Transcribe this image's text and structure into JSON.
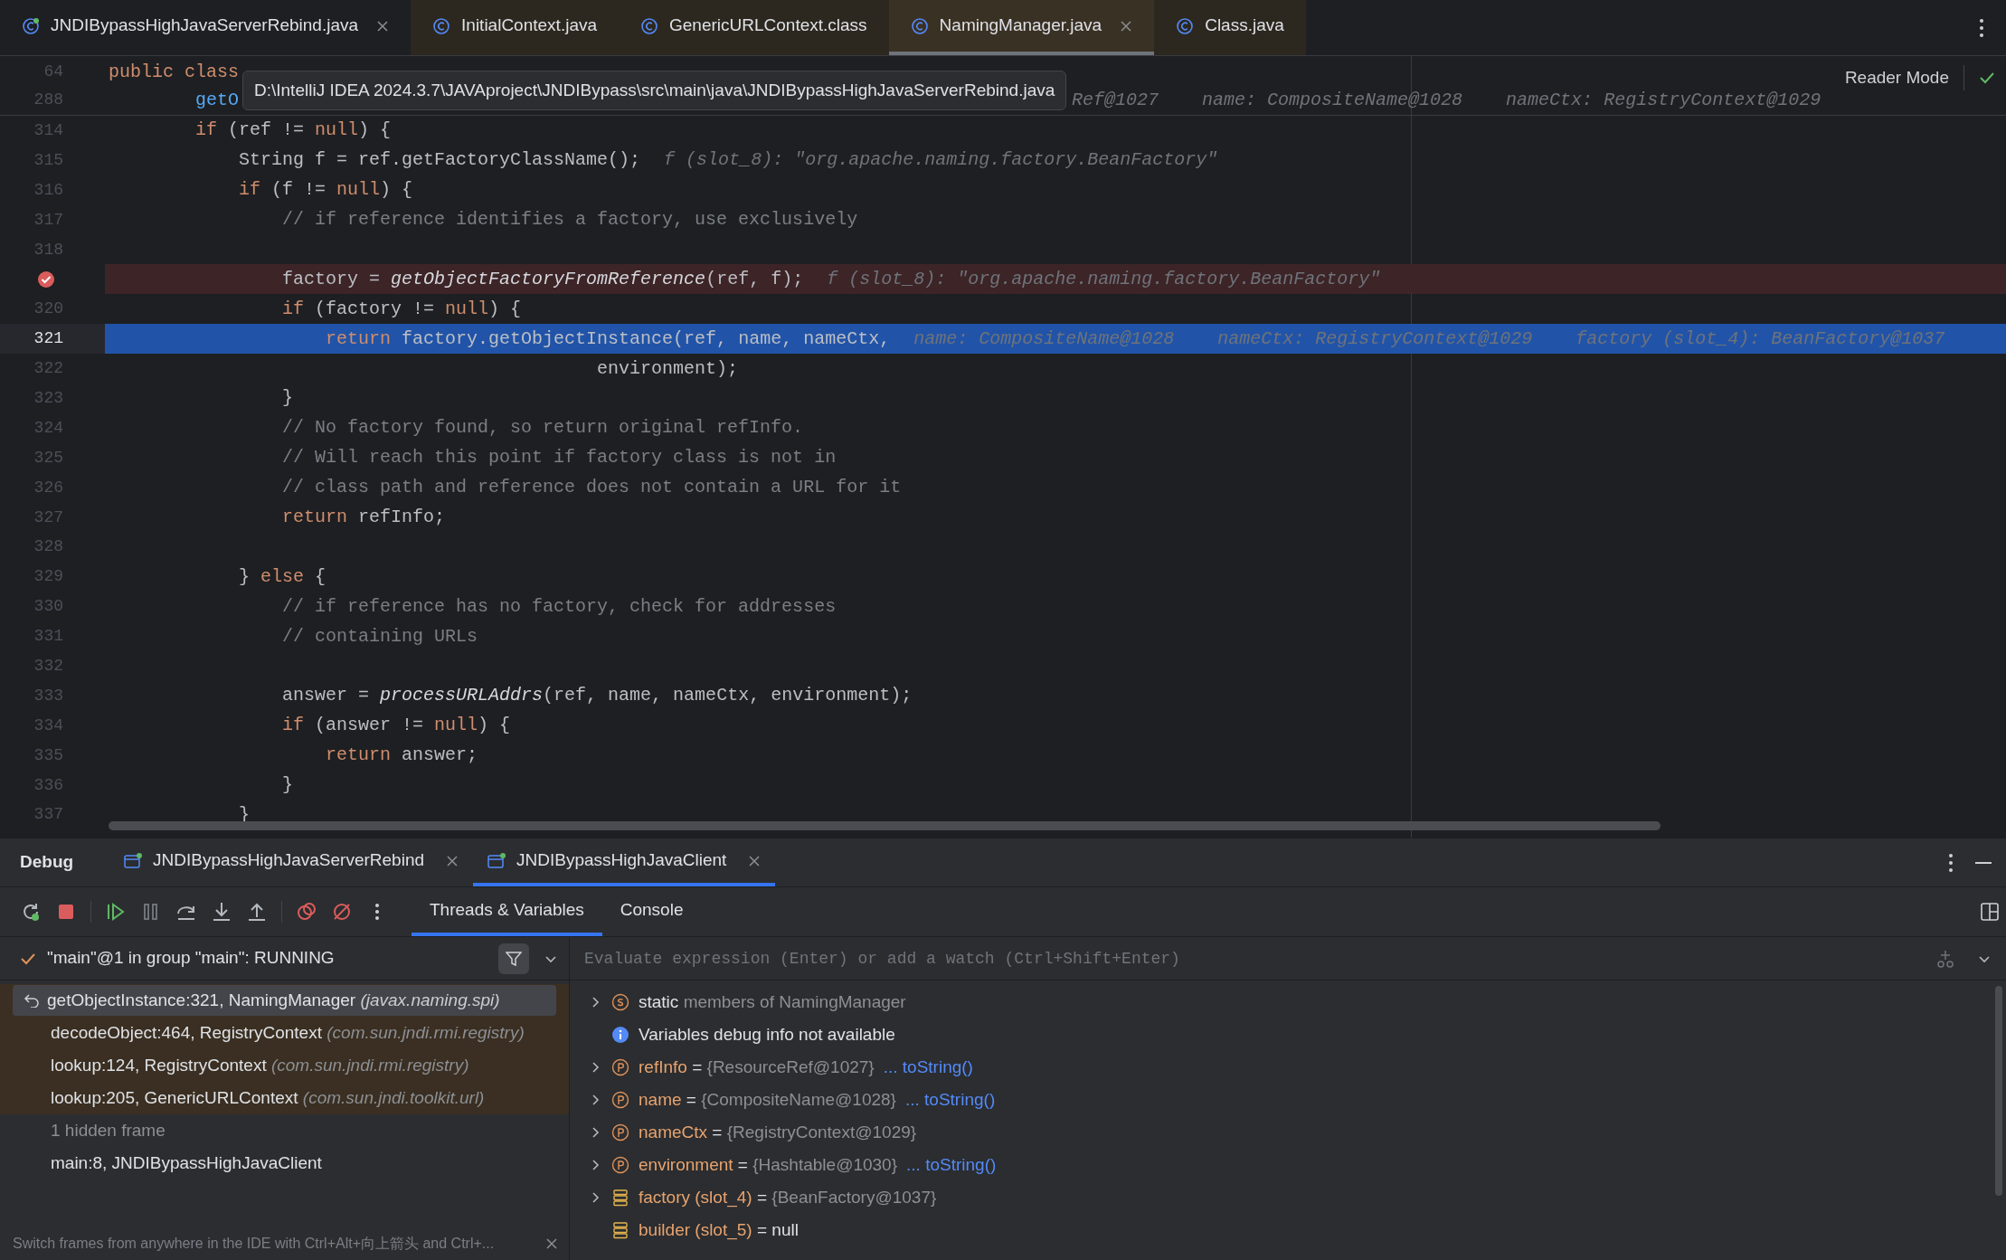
{
  "editor_tabs": [
    {
      "label": "JNDIBypassHighJavaServerRebind.java",
      "selected": false,
      "library": false,
      "closable": true,
      "runnable": true
    },
    {
      "label": "InitialContext.java",
      "selected": false,
      "library": true,
      "closable": false,
      "runnable": false
    },
    {
      "label": "GenericURLContext.class",
      "selected": false,
      "library": true,
      "closable": false,
      "runnable": false
    },
    {
      "label": "NamingManager.java",
      "selected": true,
      "library": true,
      "closable": true,
      "runnable": false
    },
    {
      "label": "Class.java",
      "selected": false,
      "library": true,
      "closable": false,
      "runnable": false
    }
  ],
  "reader_mode": "Reader Mode",
  "tooltip": "D:\\IntelliJ IDEA 2024.3.7\\JAVAproject\\JNDIBypass\\src\\main\\java\\JNDIBypassHighJavaServerRebind.java",
  "sticky_lines": [
    {
      "number": "64",
      "segments": [
        {
          "kind": "keyword",
          "text": "public class"
        }
      ]
    },
    {
      "number": "288",
      "segments": [
        {
          "kind": "method",
          "text": "        getO"
        },
        {
          "kind": "hint",
          "text": "Ref@1027    name: CompositeName@1028    nameCtx: RegistryContext@1029"
        }
      ]
    }
  ],
  "code_lines": [
    {
      "number": "314",
      "breakpoint": false,
      "current": false,
      "segments": [
        {
          "kind": "keyword",
          "text": "        if"
        },
        {
          "kind": "plain",
          "text": " (ref != "
        },
        {
          "kind": "keyword",
          "text": "null"
        },
        {
          "kind": "plain",
          "text": ") {"
        }
      ]
    },
    {
      "number": "315",
      "breakpoint": false,
      "current": false,
      "segments": [
        {
          "kind": "plain",
          "text": "            String f = ref.getFactoryClassName();"
        },
        {
          "kind": "hint",
          "text": "f (slot_8): \"org.apache.naming.factory.BeanFactory\""
        }
      ]
    },
    {
      "number": "316",
      "breakpoint": false,
      "current": false,
      "segments": [
        {
          "kind": "keyword",
          "text": "            if"
        },
        {
          "kind": "plain",
          "text": " (f != "
        },
        {
          "kind": "keyword",
          "text": "null"
        },
        {
          "kind": "plain",
          "text": ") {"
        }
      ]
    },
    {
      "number": "317",
      "breakpoint": false,
      "current": false,
      "segments": [
        {
          "kind": "comment",
          "text": "                // if reference identifies a factory, use exclusively"
        }
      ]
    },
    {
      "number": "318",
      "breakpoint": false,
      "current": false
    },
    {
      "breakpoint": true,
      "current": false,
      "segments": [
        {
          "kind": "plain",
          "text": "                factory = "
        },
        {
          "kind": "static",
          "text": "getObjectFactoryFromReference"
        },
        {
          "kind": "plain",
          "text": "(ref, f);"
        },
        {
          "kind": "hint",
          "text": "f (slot_8): \"org.apache.naming.factory.BeanFactory\""
        }
      ]
    },
    {
      "number": "320",
      "breakpoint": false,
      "current": false,
      "segments": [
        {
          "kind": "keyword",
          "text": "                if"
        },
        {
          "kind": "plain",
          "text": " (factory != "
        },
        {
          "kind": "keyword",
          "text": "null"
        },
        {
          "kind": "plain",
          "text": ") {"
        }
      ]
    },
    {
      "number": "321",
      "breakpoint": false,
      "current": true,
      "segments": [
        {
          "kind": "keyword",
          "text": "                    return"
        },
        {
          "kind": "plain",
          "text": " factory.getObjectInstance(ref, name, nameCtx,"
        },
        {
          "kind": "hint",
          "text": "name: CompositeName@1028    nameCtx: RegistryContext@1029    factory (slot_4): BeanFactory@1037"
        }
      ]
    },
    {
      "number": "322",
      "breakpoint": false,
      "current": false,
      "segments": [
        {
          "kind": "plain",
          "text": "                                             environment);"
        }
      ]
    },
    {
      "number": "323",
      "breakpoint": false,
      "current": false,
      "segments": [
        {
          "kind": "plain",
          "text": "                }"
        }
      ]
    },
    {
      "number": "324",
      "breakpoint": false,
      "current": false,
      "segments": [
        {
          "kind": "comment",
          "text": "                // No factory found, so return original refInfo."
        }
      ]
    },
    {
      "number": "325",
      "breakpoint": false,
      "current": false,
      "segments": [
        {
          "kind": "comment",
          "text": "                // Will reach this point if factory class is not in"
        }
      ]
    },
    {
      "number": "326",
      "breakpoint": false,
      "current": false,
      "segments": [
        {
          "kind": "comment",
          "text": "                // class path and reference does not contain a URL for it"
        }
      ]
    },
    {
      "number": "327",
      "breakpoint": false,
      "current": false,
      "segments": [
        {
          "kind": "keyword",
          "text": "                return"
        },
        {
          "kind": "plain",
          "text": " refInfo;"
        }
      ]
    },
    {
      "number": "328",
      "breakpoint": false,
      "current": false
    },
    {
      "number": "329",
      "breakpoint": false,
      "current": false,
      "segments": [
        {
          "kind": "plain",
          "text": "            } "
        },
        {
          "kind": "keyword",
          "text": "else"
        },
        {
          "kind": "plain",
          "text": " {"
        }
      ]
    },
    {
      "number": "330",
      "breakpoint": false,
      "current": false,
      "segments": [
        {
          "kind": "comment",
          "text": "                // if reference has no factory, check for addresses"
        }
      ]
    },
    {
      "number": "331",
      "breakpoint": false,
      "current": false,
      "segments": [
        {
          "kind": "comment",
          "text": "                // containing URLs"
        }
      ]
    },
    {
      "number": "332",
      "breakpoint": false,
      "current": false
    },
    {
      "number": "333",
      "breakpoint": false,
      "current": false,
      "segments": [
        {
          "kind": "plain",
          "text": "                answer = "
        },
        {
          "kind": "static",
          "text": "processURLAddrs"
        },
        {
          "kind": "plain",
          "text": "(ref, name, nameCtx, environment);"
        }
      ]
    },
    {
      "number": "334",
      "breakpoint": false,
      "current": false,
      "segments": [
        {
          "kind": "keyword",
          "text": "                if"
        },
        {
          "kind": "plain",
          "text": " (answer != "
        },
        {
          "kind": "keyword",
          "text": "null"
        },
        {
          "kind": "plain",
          "text": ") {"
        }
      ]
    },
    {
      "number": "335",
      "breakpoint": false,
      "current": false,
      "segments": [
        {
          "kind": "keyword",
          "text": "                    return"
        },
        {
          "kind": "plain",
          "text": " answer;"
        }
      ]
    },
    {
      "number": "336",
      "breakpoint": false,
      "current": false,
      "segments": [
        {
          "kind": "plain",
          "text": "                }"
        }
      ]
    },
    {
      "number": "337",
      "breakpoint": false,
      "current": false,
      "segments": [
        {
          "kind": "plain",
          "text": "            }"
        }
      ]
    }
  ],
  "debug": {
    "title": "Debug",
    "sessions": [
      {
        "label": "JNDIBypassHighJavaServerRebind",
        "selected": false
      },
      {
        "label": "JNDIBypassHighJavaClient",
        "selected": true
      }
    ],
    "view_tabs": [
      {
        "label": "Threads & Variables",
        "selected": true
      },
      {
        "label": "Console",
        "selected": false
      }
    ],
    "thread": "\"main\"@1 in group \"main\": RUNNING",
    "frames": [
      {
        "kind": "frame",
        "method": "getObjectInstance:321, NamingManager",
        "package": "(javax.naming.spi)",
        "selected": true,
        "library": true
      },
      {
        "kind": "frame",
        "method": "decodeObject:464, RegistryContext",
        "package": "(com.sun.jndi.rmi.registry)",
        "selected": false,
        "library": true
      },
      {
        "kind": "frame",
        "method": "lookup:124, RegistryContext",
        "package": "(com.sun.jndi.rmi.registry)",
        "selected": false,
        "library": true
      },
      {
        "kind": "frame",
        "method": "lookup:205, GenericURLContext",
        "package": "(com.sun.jndi.toolkit.url)",
        "selected": false,
        "library": true
      },
      {
        "kind": "hidden",
        "method": "1 hidden frame",
        "selected": false,
        "library": false
      },
      {
        "kind": "frame",
        "method": "main:8, JNDIBypassHighJavaClient",
        "selected": false,
        "library": false
      }
    ],
    "frames_hint": "Switch frames from anywhere in the IDE with Ctrl+Alt+向上箭头 and Ctrl+...",
    "evaluate": {
      "placeholder": "Evaluate expression (Enter) or add a watch (Ctrl+Shift+Enter)"
    },
    "variables": [
      {
        "kind": "static",
        "name": "static",
        "value": "members of NamingManager",
        "expandable": true
      },
      {
        "kind": "info",
        "name": "Variables debug info not available",
        "expandable": false
      },
      {
        "kind": "param",
        "name": "refInfo",
        "sep": "=",
        "value": "{ResourceRef@1027}",
        "link": "... toString()",
        "expandable": true
      },
      {
        "kind": "param",
        "name": "name",
        "sep": "=",
        "value": "{CompositeName@1028}",
        "link": "... toString()",
        "expandable": true
      },
      {
        "kind": "param",
        "name": "nameCtx",
        "sep": "=",
        "value": "{RegistryContext@1029}",
        "expandable": true
      },
      {
        "kind": "param",
        "name": "environment",
        "sep": "=",
        "value": "{Hashtable@1030}",
        "link": "... toString()",
        "expandable": true
      },
      {
        "kind": "local",
        "name": "factory (slot_4)",
        "sep": "=",
        "value": "{BeanFactory@1037}",
        "expandable": true
      },
      {
        "kind": "local",
        "name": "builder (slot_5)",
        "sep": "=",
        "value": "null",
        "plain_value": true,
        "expandable": false
      }
    ]
  }
}
